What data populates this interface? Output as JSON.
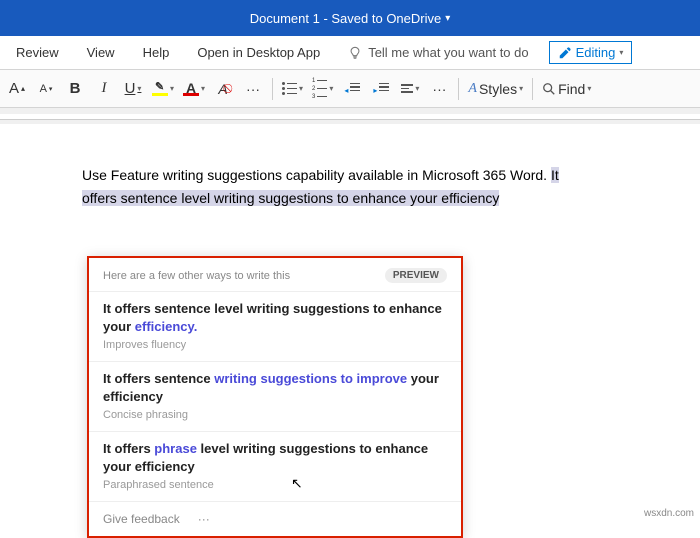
{
  "title": {
    "doc": "Document 1",
    "status": "Saved to OneDrive"
  },
  "menu": {
    "review": "Review",
    "view": "View",
    "help": "Help",
    "open_desktop": "Open in Desktop App",
    "search_prompt": "Tell me what you want to do",
    "editing": "Editing"
  },
  "ribbon": {
    "styles": "Styles",
    "find": "Find"
  },
  "document": {
    "line1": "Use Feature writing suggestions capability available in Microsoft 365 Word. ",
    "hl_a": "It",
    "hl_b": "offers sentence level writing suggestions to enhance your efficiency"
  },
  "card": {
    "heading": "Here are a few other ways to write this",
    "preview": "PREVIEW",
    "suggestions": [
      {
        "pre": "It offers sentence level writing suggestions to enhance your ",
        "em": "efficiency.",
        "post": "",
        "sub": "Improves fluency"
      },
      {
        "pre": "It offers sentence ",
        "em": "writing suggestions to improve",
        "post": " your efficiency",
        "sub": "Concise phrasing"
      },
      {
        "pre": "It offers ",
        "em": "phrase",
        "post": " level writing suggestions to enhance your efficiency",
        "sub": "Paraphrased sentence"
      }
    ],
    "feedback": "Give feedback",
    "more": "···"
  },
  "watermark": "wsxdn.com"
}
